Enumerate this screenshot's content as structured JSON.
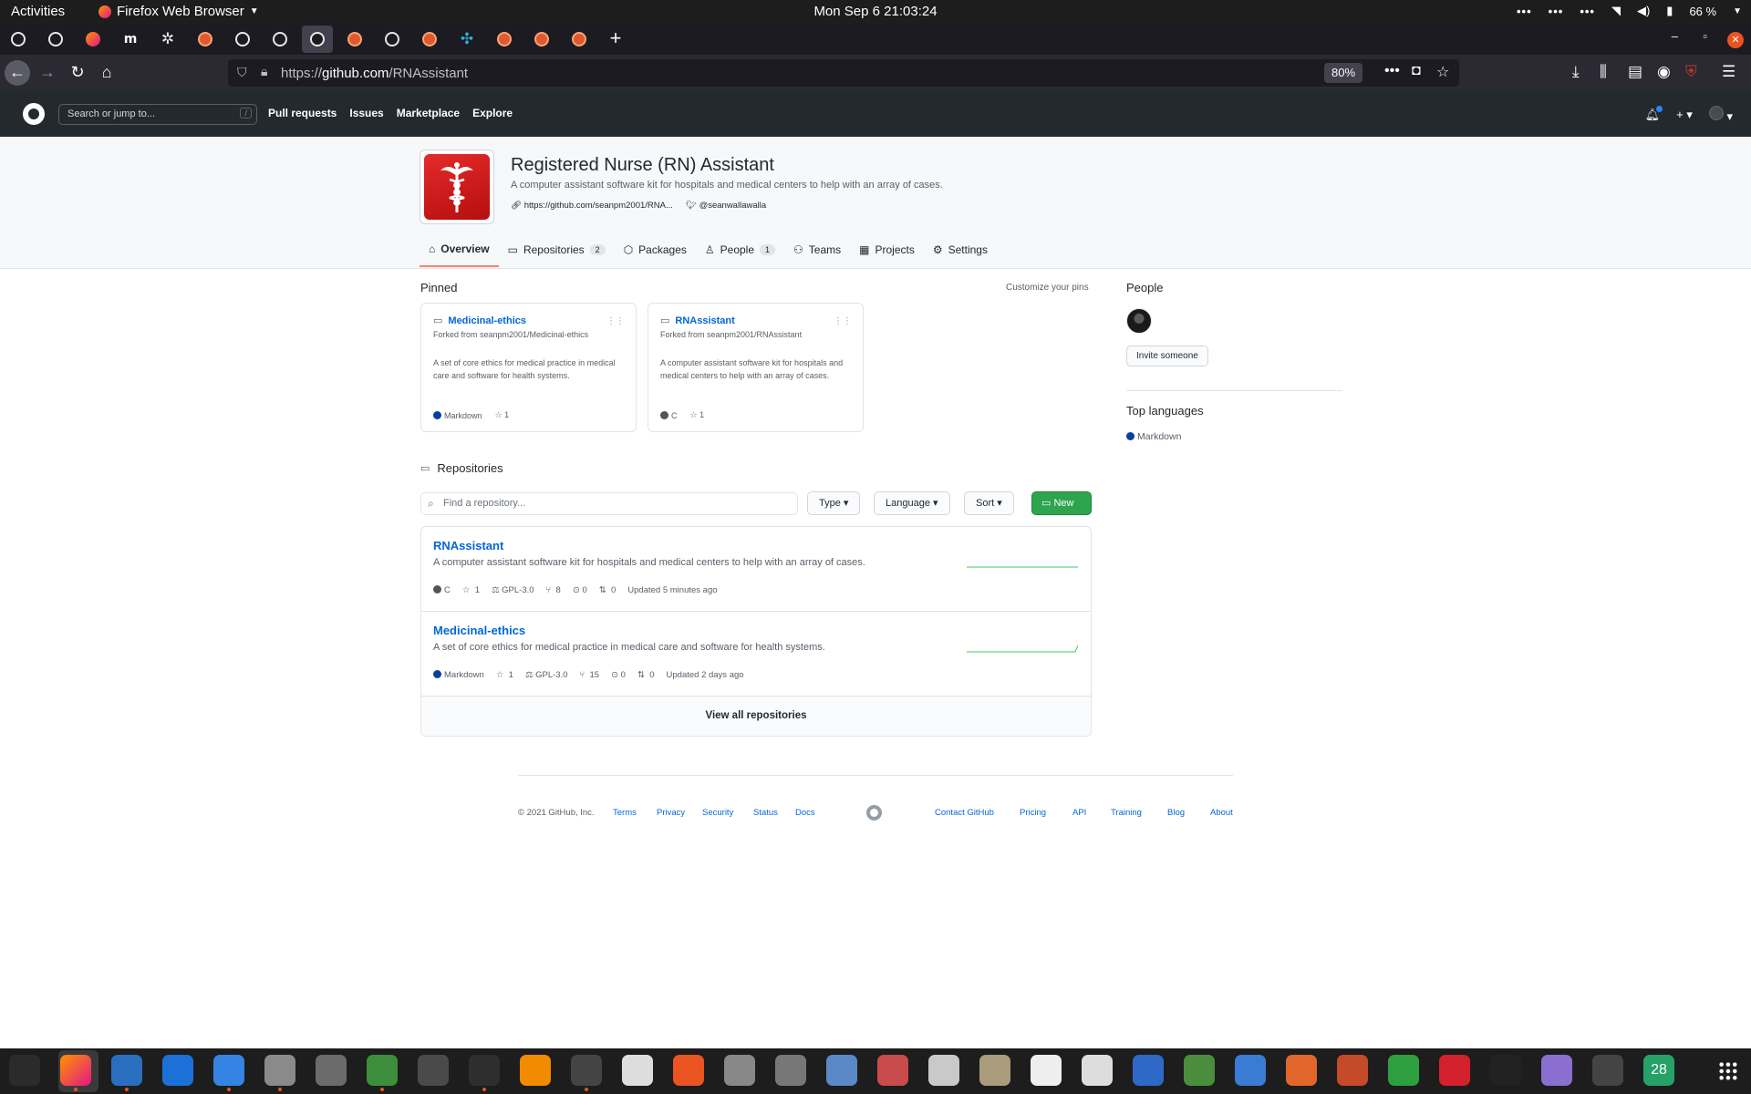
{
  "system_bar": {
    "activities": "Activities",
    "app_name": "Firefox Web Browser",
    "clock": "Mon Sep 6  21:03:24",
    "battery": "66 %"
  },
  "browser": {
    "url_prefix": "https://",
    "url_host": "github.com",
    "url_path": "/RNAssistant",
    "zoom": "80%",
    "tab_icons": [
      "github",
      "github",
      "firefox",
      "m",
      "gear",
      "duckduckgo",
      "github",
      "github",
      "github",
      "duckduckgo",
      "github",
      "duckduckgo",
      "teal-cross",
      "duckduckgo",
      "duckduckgo",
      "duckduckgo"
    ],
    "active_tab_index": 8,
    "ublock_badge": "3"
  },
  "gh_header": {
    "search_placeholder": "Search or jump to...",
    "search_key": "/",
    "nav": [
      "Pull requests",
      "Issues",
      "Marketplace",
      "Explore"
    ]
  },
  "org": {
    "name": "Registered Nurse (RN) Assistant",
    "description": "A computer assistant software kit for hospitals and medical centers to help with an array of cases.",
    "website": "https://github.com/seanpm2001/RNA...",
    "twitter": "@seanwallawalla",
    "tabs": [
      {
        "label": "Overview",
        "count": ""
      },
      {
        "label": "Repositories",
        "count": "2"
      },
      {
        "label": "Packages",
        "count": ""
      },
      {
        "label": "People",
        "count": "1"
      },
      {
        "label": "Teams",
        "count": ""
      },
      {
        "label": "Projects",
        "count": ""
      },
      {
        "label": "Settings",
        "count": ""
      }
    ]
  },
  "pinned": {
    "heading": "Pinned",
    "customize": "Customize your pins",
    "items": [
      {
        "name": "Medicinal-ethics",
        "fork": "Forked from seanpm2001/Medicinal-ethics",
        "description": "A set of core ethics for medical practice in medical care and software for health systems.",
        "language": "Markdown",
        "language_color": "#083fa1",
        "stars": "1"
      },
      {
        "name": "RNAssistant",
        "fork": "Forked from seanpm2001/RNAssistant",
        "description": "A computer assistant software kit for hospitals and medical centers to help with an array of cases.",
        "language": "C",
        "language_color": "#555555",
        "stars": "1"
      }
    ]
  },
  "repositories": {
    "heading": "Repositories",
    "find_placeholder": "Find a repository...",
    "type_label": "Type",
    "language_label": "Language",
    "sort_label": "Sort",
    "new_label": "New",
    "view_all": "View all repositories",
    "items": [
      {
        "name": "RNAssistant",
        "description": "A computer assistant software kit for hospitals and medical centers to help with an array of cases.",
        "language": "C",
        "language_color": "#555555",
        "stars": "1",
        "license": "GPL-3.0",
        "forks": "8",
        "issues": "0",
        "prs": "0",
        "updated": "Updated 5 minutes ago"
      },
      {
        "name": "Medicinal-ethics",
        "description": "A set of core ethics for medical practice in medical care and software for health systems.",
        "language": "Markdown",
        "language_color": "#083fa1",
        "stars": "1",
        "license": "GPL-3.0",
        "forks": "15",
        "issues": "0",
        "prs": "0",
        "updated": "Updated 2 days ago"
      }
    ]
  },
  "sidebar": {
    "people_heading": "People",
    "invite": "Invite someone",
    "languages_heading": "Top languages",
    "languages": [
      {
        "name": "Markdown",
        "color": "#083fa1"
      }
    ]
  },
  "footer": {
    "copyright": "© 2021 GitHub, Inc.",
    "links_left": [
      "Terms",
      "Privacy",
      "Security",
      "Status",
      "Docs"
    ],
    "links_right": [
      "Contact GitHub",
      "Pricing",
      "API",
      "Training",
      "Blog",
      "About"
    ]
  },
  "colors": {
    "accent_link": "#0366d6",
    "new_button": "#2ea44f",
    "tab_underline": "#f9826c",
    "ubuntu_orange": "#e95420"
  },
  "dock": {
    "calendar_day": "28"
  }
}
